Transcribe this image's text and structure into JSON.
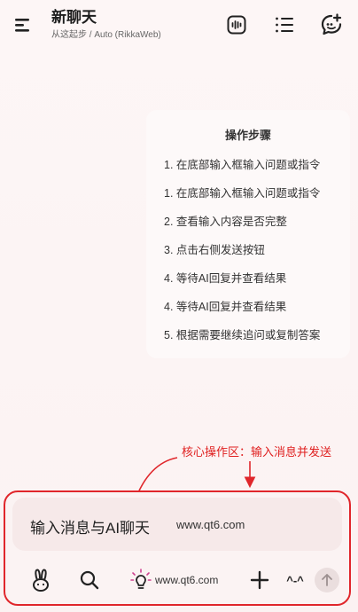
{
  "header": {
    "title": "新聊天",
    "subtitle": "从这起步 / Auto (RikkaWeb)",
    "icons": [
      "menu-icon",
      "voice-wave-icon",
      "list-icon",
      "new-chat-icon"
    ]
  },
  "steps": {
    "title": "操作步骤",
    "items": [
      "1. 在底部输入框输入问题或指令",
      "1. 在底部输入框输入问题或指令",
      "2. 查看输入内容是否完整",
      "3. 点击右侧发送按钮",
      "4. 等待AI回复并查看结果",
      "4. 等待AI回复并查看结果",
      "5. 根据需要继续追问或复制答案"
    ]
  },
  "annotation": {
    "label": "核心操作区：输入消息并发送",
    "color": "#e0262b"
  },
  "composer": {
    "placeholder": "输入消息与AI聊天",
    "url": "www.qt6.com",
    "toolbar": {
      "bulb_url": "www.qt6.com",
      "face_label": "^-^",
      "icons": [
        "bunny-icon",
        "search-icon",
        "lightbulb-icon",
        "plus-icon",
        "face-icon",
        "send-arrow-icon"
      ]
    }
  }
}
